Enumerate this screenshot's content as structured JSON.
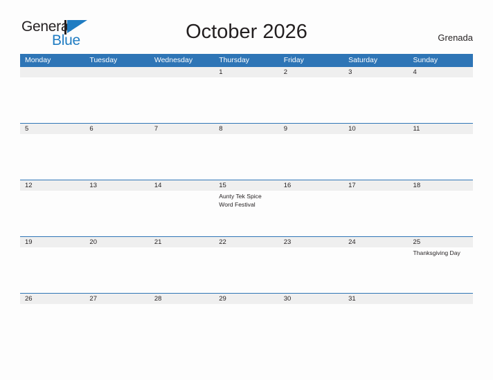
{
  "brand": {
    "name_part1": "General",
    "name_part2": "Blue",
    "flag_icon": "blue-triangle-flag-icon",
    "accent_color": "#1f7cc2"
  },
  "header": {
    "title": "October 2026",
    "locale": "Grenada"
  },
  "colors": {
    "header_blue": "#2e75b6",
    "date_band_gray": "#efefef",
    "page_background": "#fdfdfd",
    "text": "#231f20"
  },
  "calendar": {
    "weekdays": [
      "Monday",
      "Tuesday",
      "Wednesday",
      "Thursday",
      "Friday",
      "Saturday",
      "Sunday"
    ],
    "weeks": [
      {
        "days": [
          {
            "num": "",
            "events": []
          },
          {
            "num": "",
            "events": []
          },
          {
            "num": "",
            "events": []
          },
          {
            "num": "1",
            "events": []
          },
          {
            "num": "2",
            "events": []
          },
          {
            "num": "3",
            "events": []
          },
          {
            "num": "4",
            "events": []
          }
        ]
      },
      {
        "days": [
          {
            "num": "5",
            "events": []
          },
          {
            "num": "6",
            "events": []
          },
          {
            "num": "7",
            "events": []
          },
          {
            "num": "8",
            "events": []
          },
          {
            "num": "9",
            "events": []
          },
          {
            "num": "10",
            "events": []
          },
          {
            "num": "11",
            "events": []
          }
        ]
      },
      {
        "days": [
          {
            "num": "12",
            "events": []
          },
          {
            "num": "13",
            "events": []
          },
          {
            "num": "14",
            "events": []
          },
          {
            "num": "15",
            "events": [
              "Aunty Tek Spice Word Festival"
            ]
          },
          {
            "num": "16",
            "events": []
          },
          {
            "num": "17",
            "events": []
          },
          {
            "num": "18",
            "events": []
          }
        ]
      },
      {
        "days": [
          {
            "num": "19",
            "events": []
          },
          {
            "num": "20",
            "events": []
          },
          {
            "num": "21",
            "events": []
          },
          {
            "num": "22",
            "events": []
          },
          {
            "num": "23",
            "events": []
          },
          {
            "num": "24",
            "events": []
          },
          {
            "num": "25",
            "events": [
              "Thanksgiving Day"
            ]
          }
        ]
      },
      {
        "days": [
          {
            "num": "26",
            "events": []
          },
          {
            "num": "27",
            "events": []
          },
          {
            "num": "28",
            "events": []
          },
          {
            "num": "29",
            "events": []
          },
          {
            "num": "30",
            "events": []
          },
          {
            "num": "31",
            "events": []
          },
          {
            "num": "",
            "events": []
          }
        ]
      }
    ]
  }
}
